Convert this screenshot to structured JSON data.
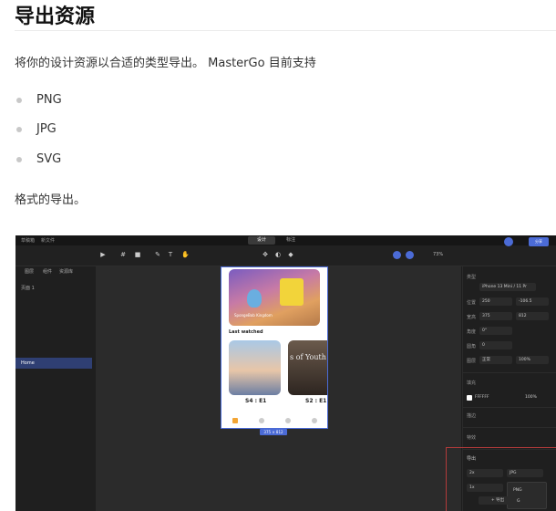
{
  "heading": "导出资源",
  "intro": "将你的设计资源以合适的类型导出。 MasterGo 目前支持",
  "formats": [
    "PNG",
    "JPG",
    "SVG"
  ],
  "outro": "格式的导出。",
  "screenshot": {
    "topbar": {
      "workspace": "草稿箱",
      "file": "新文件",
      "tab_design": "设计",
      "tab_annotate": "标注",
      "share": "分享"
    },
    "zoom": "73%",
    "left": {
      "tab_layers": "图层",
      "tab_components": "组件",
      "tab_assets": "资源库",
      "page": "页面 1",
      "frame": "Home"
    },
    "canvas": {
      "hero_text": "SpongeBob Kingdom",
      "last_watched": "Last watched",
      "card2_text": "s of Youth",
      "ep1": "S4 : E1",
      "ep2": "S2 : E1",
      "frame_size": "375 × 812"
    },
    "right": {
      "type_label": "类型",
      "device": "iPhone 13 Mini / 11 Pr",
      "pos_label": "位置",
      "x": "250",
      "y": "-106.5",
      "size_label": "宽高",
      "w": "375",
      "h": "812",
      "angle_label": "角度",
      "angle": "0°",
      "radius_label": "圆角",
      "radius": "0",
      "layer_label": "图层",
      "blend": "正常",
      "opacity": "100%",
      "fill_label": "填充",
      "fill_hex": "FFFFFF",
      "fill_opacity": "100%",
      "stroke_label": "描边",
      "effect_label": "特效",
      "export_label": "导出",
      "scale1": "2x",
      "format1": "JPG",
      "scale2": "1x",
      "opt_png": "PNG",
      "opt_jpg": "JPG",
      "export_button": "+ 导出"
    }
  }
}
